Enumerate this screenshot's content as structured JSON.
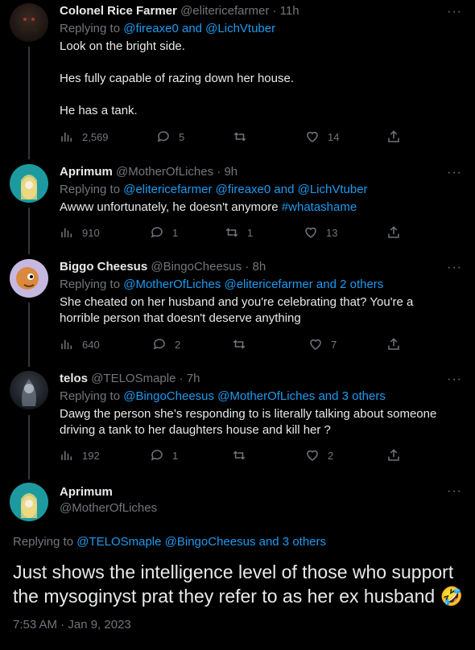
{
  "tweets": [
    {
      "name": "Colonel Rice Farmer",
      "handle": "@elitericefarmer",
      "time": "11h",
      "replying_prefix": "Replying to ",
      "replying_to": "@fireaxe0 and @LichVtuber",
      "lines": [
        "Look on the bright side.",
        "Hes fully capable of razing down her house.",
        "He has a tank."
      ],
      "views": "2,569",
      "replies": "5",
      "retweets": "",
      "likes": "14"
    },
    {
      "name": "Aprimum",
      "handle": "@MotherOfLiches",
      "time": "9h",
      "replying_prefix": "Replying to ",
      "replying_to": "@elitericefarmer @fireaxe0 and @LichVtuber",
      "text": "Awww unfortunately,  he doesn't anymore ",
      "hashtag": "#whatashame",
      "views": "910",
      "replies": "1",
      "retweets": "1",
      "likes": "13"
    },
    {
      "name": "Biggo Cheesus",
      "handle": "@BingoCheesus",
      "time": "8h",
      "replying_prefix": "Replying to ",
      "replying_to": "@MotherOfLiches @elitericefarmer and 2 others",
      "text": "She cheated on her husband and you're celebrating that? You're a horrible person that doesn't deserve anything",
      "views": "640",
      "replies": "2",
      "retweets": "",
      "likes": "7"
    },
    {
      "name": "telos",
      "handle": "@TELOSmaple",
      "time": "7h",
      "replying_prefix": "Replying to ",
      "replying_to": "@BingoCheesus @MotherOfLiches and 3 others",
      "text": "Dawg the person she’s responding to is literally talking about someone driving a tank to her daughters house and kill her ?",
      "views": "192",
      "replies": "1",
      "retweets": "",
      "likes": "2"
    }
  ],
  "main": {
    "name": "Aprimum",
    "handle": "@MotherOfLiches",
    "replying_prefix": "Replying to ",
    "replying_to": "@TELOSmaple @BingoCheesus and 3 others",
    "text": "Just shows the intelligence level of those who support the mysoginyst prat they refer to as her ex husband ",
    "emoji": "🤣",
    "timestamp": "7:53 AM · Jan 9, 2023"
  },
  "more_label": "···",
  "colors": {
    "accent": "#1d9bf0",
    "muted": "#71767b",
    "bg": "#000000",
    "text": "#e7e9ea"
  }
}
